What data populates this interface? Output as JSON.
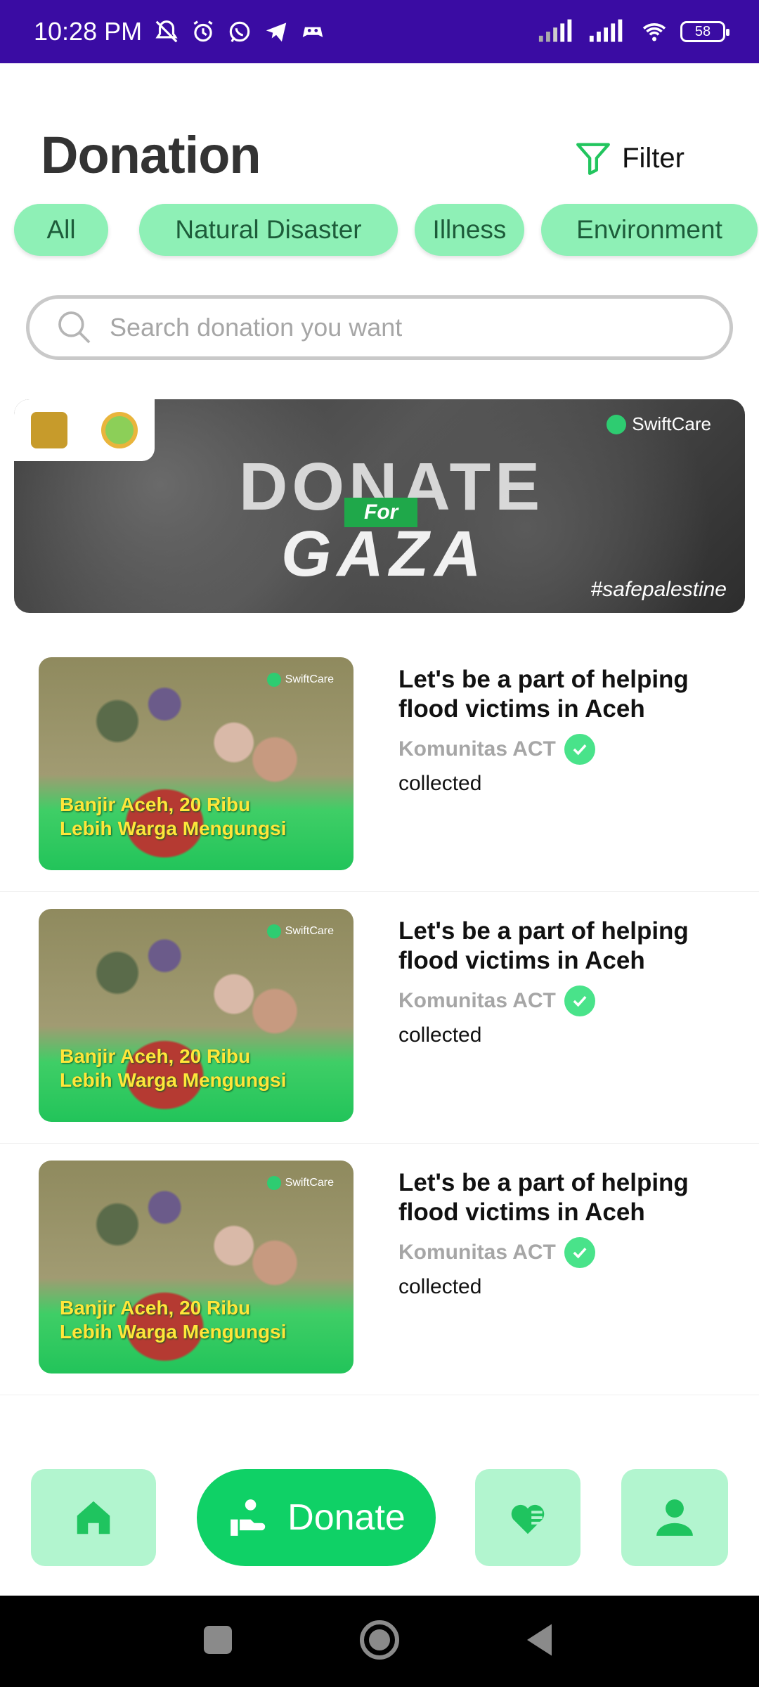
{
  "status_bar": {
    "time": "10:28 PM",
    "battery": "58",
    "icons": [
      "mute-bell-icon",
      "alarm-icon",
      "whatsapp-icon",
      "telegram-icon",
      "game-icon",
      "signal-icon",
      "signal-icon",
      "wifi-icon",
      "battery-icon"
    ]
  },
  "header": {
    "title": "Donation",
    "filter_label": "Filter"
  },
  "categories": [
    "All",
    "Natural Disaster",
    "Illness",
    "Environment"
  ],
  "search": {
    "placeholder": "Search donation you want",
    "value": ""
  },
  "banner": {
    "title": "DONATE",
    "for": "For",
    "subtitle": "GAZA",
    "brand": "SwiftCare",
    "hashtag": "#safepalestine"
  },
  "donations": [
    {
      "image_caption_line1": "Banjir Aceh, 20 Ribu",
      "image_caption_line2": "Lebih Warga Mengungsi",
      "image_brand": "SwiftCare",
      "title": "Let's be a part of helping flood victims in Aceh",
      "organizer": "Komunitas ACT",
      "collected": "collected"
    },
    {
      "image_caption_line1": "Banjir Aceh, 20 Ribu",
      "image_caption_line2": "Lebih Warga Mengungsi",
      "image_brand": "SwiftCare",
      "title": "Let's be a part of helping flood victims in Aceh",
      "organizer": "Komunitas ACT",
      "collected": "collected"
    },
    {
      "image_caption_line1": "Banjir Aceh, 20 Ribu",
      "image_caption_line2": "Lebih Warga Mengungsi",
      "image_brand": "SwiftCare",
      "title": "Let's be a part of helping flood victims in Aceh",
      "organizer": "Komunitas ACT",
      "collected": "collected"
    }
  ],
  "bottom_nav": {
    "donate_label": "Donate",
    "items": [
      "home-icon",
      "donate-hand-icon",
      "favorite-heart-icon",
      "profile-icon"
    ]
  },
  "colors": {
    "status_bar": "#3a0ca3",
    "chip": "#8ef0b6",
    "accent": "#0fd166",
    "nav_item": "#b2f5cf",
    "verified": "#49e38a"
  }
}
